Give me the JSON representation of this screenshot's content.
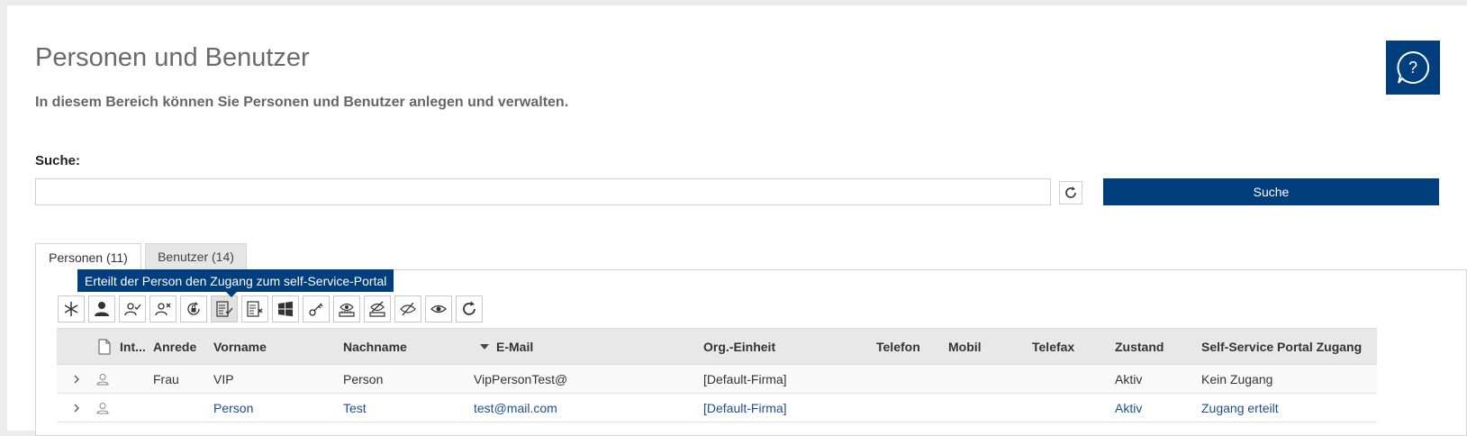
{
  "page": {
    "title": "Personen und Benutzer",
    "subtitle": "In diesem Bereich können Sie Personen und Benutzer anlegen und verwalten."
  },
  "help": {
    "icon": "help-question-icon"
  },
  "search": {
    "label": "Suche:",
    "value": "",
    "placeholder": "",
    "button_label": "Suche",
    "refresh_icon": "refresh-icon"
  },
  "tabs": [
    {
      "label": "Personen (11)",
      "active": true
    },
    {
      "label": "Benutzer (14)",
      "active": false
    }
  ],
  "tooltip": {
    "text": "Erteilt der Person den Zugang zum self-Service-Portal"
  },
  "toolbar": {
    "buttons": [
      {
        "icon": "asterisk-icon"
      },
      {
        "icon": "person-icon"
      },
      {
        "icon": "person-check-icon"
      },
      {
        "icon": "person-x-icon"
      },
      {
        "icon": "lock-refresh-icon"
      },
      {
        "icon": "list-check-icon",
        "active": true
      },
      {
        "icon": "list-x-icon"
      },
      {
        "icon": "windows-icon"
      },
      {
        "icon": "key-icon"
      },
      {
        "icon": "hand-eye-icon"
      },
      {
        "icon": "hand-eye-slash-icon"
      },
      {
        "icon": "eye-slash-icon"
      },
      {
        "icon": "eye-icon"
      },
      {
        "icon": "refresh-icon"
      }
    ]
  },
  "table": {
    "columns": {
      "int": "Int...",
      "anrede": "Anrede",
      "vorname": "Vorname",
      "nachname": "Nachname",
      "email": "E-Mail",
      "org": "Org.-Einheit",
      "telefon": "Telefon",
      "mobil": "Mobil",
      "telefax": "Telefax",
      "zustand": "Zustand",
      "portal": "Self-Service Portal Zugang"
    },
    "rows": [
      {
        "anrede": "Frau",
        "vorname": "VIP",
        "nachname": "Person",
        "email": "VipPersonTest@",
        "org": "[Default-Firma]",
        "telefon": "",
        "mobil": "",
        "telefax": "",
        "zustand": "Aktiv",
        "portal": "Kein Zugang"
      },
      {
        "anrede": "",
        "vorname": "Person",
        "nachname": "Test",
        "email": "test@mail.com",
        "org": "[Default-Firma]",
        "telefon": "",
        "mobil": "",
        "telefax": "",
        "zustand": "Aktiv",
        "portal": "Zugang erteilt"
      }
    ]
  },
  "colors": {
    "accent": "#003e7e",
    "link": "#1d4f8f"
  }
}
